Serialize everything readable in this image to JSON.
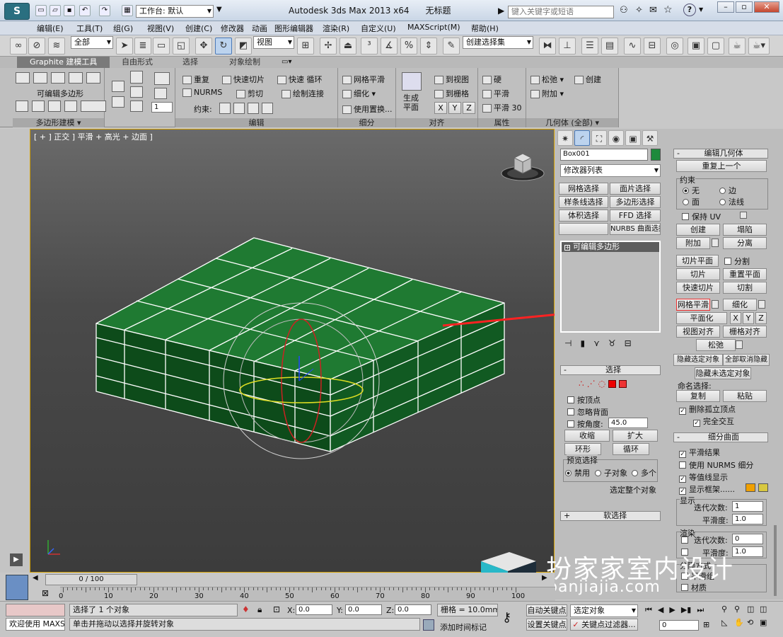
{
  "title_bar": {
    "workspace_label": "工作台: 默认",
    "app_title": "Autodesk 3ds Max  2013 x64",
    "doc_title": "无标题",
    "search_placeholder": "键入关键字或短语"
  },
  "menus": [
    "编辑(E)",
    "工具(T)",
    "组(G)",
    "视图(V)",
    "创建(C)",
    "修改器",
    "动画",
    "图形编辑器",
    "渲染(R)",
    "自定义(U)",
    "MAXScript(M)",
    "帮助(H)"
  ],
  "main_toolbar": {
    "selection_filter": "全部",
    "ref_coord": "视图",
    "named_selection": "创建选择集"
  },
  "ribbon": {
    "tabs": [
      "Graphite 建模工具",
      "自由形式",
      "选择",
      "对象绘制"
    ],
    "poly_label": "可编辑多边形",
    "poly_footer": "多边形建模",
    "edit": {
      "items": [
        "重复",
        "快速切片",
        "快速 循环",
        "NURMS",
        "剪切",
        "绘制连接"
      ],
      "constrain_label": "约束:",
      "footer": "编辑"
    },
    "subdiv": {
      "items": [
        "网格平滑",
        "细化",
        "使用置换..."
      ],
      "footer": "细分"
    },
    "align": {
      "gen_plane": "生成平面",
      "items": [
        "到视图",
        "到栅格"
      ],
      "axes": [
        "X",
        "Y",
        "Z"
      ],
      "footer": "对齐"
    },
    "props": {
      "items": [
        "硬",
        "平滑",
        "平滑 30"
      ],
      "footer": "属性"
    },
    "geom": {
      "items": [
        "松弛",
        "创建",
        "附加"
      ],
      "footer": "几何体 (全部)"
    },
    "spinner_val": "1"
  },
  "viewport": {
    "label": "[ + ] 正交 ] 平滑 + 高光 + 边面 ]"
  },
  "command_panel": {
    "object_name": "Box001",
    "object_color": "#1e8a3c",
    "modifier_list": "修改器列表",
    "mod_buttons": [
      "网格选择",
      "面片选择",
      "样条线选择",
      "多边形选择",
      "体积选择",
      "FFD 选择",
      "",
      "NURBS 曲面选择"
    ],
    "stack_item": "可编辑多边形",
    "selection": {
      "title": "选择",
      "by_vertex": "按顶点",
      "ignore_backface": "忽略背面",
      "by_angle": "按角度:",
      "angle": "45.0",
      "shrink": "收缩",
      "grow": "扩大",
      "ring": "环形",
      "loop": "循环",
      "preview_label": "预览选择",
      "preview_opts": [
        "禁用",
        "子对象",
        "多个"
      ],
      "select_whole": "选定整个对象"
    },
    "soft_selection": "软选择",
    "edit_geom": {
      "title": "编辑几何体",
      "repeat_last": "重复上一个",
      "constraints_label": "约束",
      "constraints": [
        "无",
        "边",
        "面",
        "法线"
      ],
      "preserve_uv": "保持 UV",
      "create": "创建",
      "collapse": "塌陷",
      "attach": "附加",
      "detach": "分离",
      "slice_plane": "切片平面",
      "split": "分割",
      "slice": "切片",
      "reset_plane": "重置平面",
      "quickslice": "快速切片",
      "cut": "切割",
      "meshsmooth": "网格平滑",
      "tessellate": "细化",
      "make_planar": "平面化",
      "axes": [
        "X",
        "Y",
        "Z"
      ],
      "view_align": "视图对齐",
      "grid_align": "栅格对齐",
      "relax": "松弛",
      "hide_selected": "隐藏选定对象",
      "unhide_all": "全部取消隐藏",
      "hide_unselected": "隐藏未选定对象",
      "named_sel": "命名选择:",
      "copy": "复制",
      "paste": "粘贴",
      "delete_iso": "删除孤立顶点",
      "full_interact": "完全交互"
    },
    "subdiv": {
      "title": "细分曲面",
      "smooth_result": "平滑结果",
      "use_nurms": "使用 NURMS 细分",
      "isoline": "等值线显示",
      "show_cage": "显示框架......",
      "cage_colors": [
        "#f0a000",
        "#d8c840"
      ],
      "display_label": "显示",
      "iterations_label": "迭代次数:",
      "iterations": "1",
      "smoothness_label": "平滑度:",
      "smoothness": "1.0",
      "render_label": "渲染",
      "r_iterations": "0",
      "r_smoothness": "1.0",
      "sep_label": "分隔方式",
      "smoothing_groups": "平滑组",
      "materials": "材质"
    }
  },
  "timeline": {
    "frame": "0 / 100",
    "ticks": [
      "0",
      "10",
      "20",
      "30",
      "40",
      "50",
      "60",
      "70",
      "80",
      "90",
      "100"
    ]
  },
  "status": {
    "maxscript": "欢迎使用 MAXSc",
    "selected": "选择了 1 个对象",
    "prompt": "单击并拖动以选择并旋转对象",
    "x": "0.0",
    "y": "0.0",
    "z": "0.0",
    "grid": "栅格 = 10.0mm",
    "autokey": "自动关键点",
    "setkey": "设置关键点",
    "key_mode": "选定对象",
    "key_filters": "关键点过滤器...",
    "add_time_tag": "添加时间标记",
    "frame_field": "0"
  },
  "watermark": {
    "title": "扮家家室内设计",
    "url": "banjiajia.com"
  }
}
